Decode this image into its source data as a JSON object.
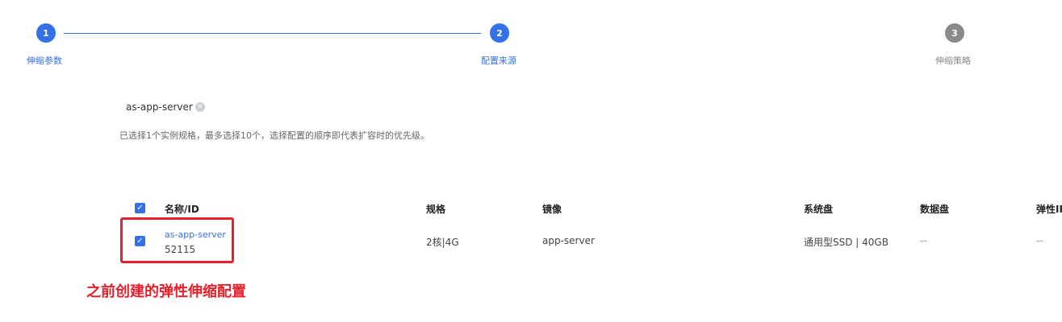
{
  "stepper": {
    "steps": [
      {
        "number": "1",
        "label": "伸缩参数"
      },
      {
        "number": "2",
        "label": "配置来源"
      },
      {
        "number": "3",
        "label": "伸缩策略"
      }
    ]
  },
  "selected_config": {
    "name": "as-app-server",
    "clear_icon": "clear-icon",
    "hint": "已选择1个实例规格，最多选择10个，选择配置的顺序即代表扩容时的优先级。"
  },
  "table": {
    "columns": [
      "名称/ID",
      "规格",
      "镜像",
      "系统盘",
      "数据盘",
      "弹性IP"
    ],
    "rows": [
      {
        "name": "as-app-server",
        "id": "52115",
        "spec": "2核|4G",
        "image": "app-server",
        "system_disk": "通用型SSD | 40GB",
        "data_disk": "--",
        "eip": "--"
      }
    ]
  },
  "annotation": {
    "text": "之前创建的弹性伸缩配置",
    "color": "#e8202a"
  },
  "colors": {
    "accent": "#3471e8",
    "inactive": "#8a8a8a"
  }
}
